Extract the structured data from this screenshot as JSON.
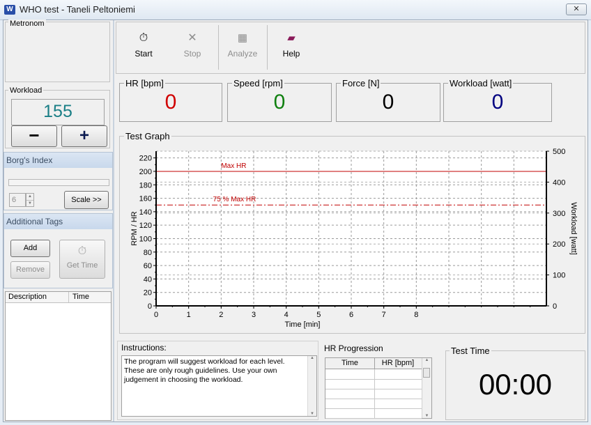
{
  "window": {
    "title": "WHO test - Taneli Peltoniemi",
    "app_icon": "W",
    "close": "✕"
  },
  "metronom": {
    "label": "Metronom"
  },
  "workload": {
    "label": "Workload",
    "value": "155",
    "minus": "−",
    "plus": "+"
  },
  "borg": {
    "label": "Borg's Index",
    "spin_value": "6",
    "scale_button": "Scale >>"
  },
  "tags": {
    "label": "Additional Tags",
    "add": "Add",
    "remove": "Remove",
    "get_time": "Get Time",
    "columns": [
      "Description",
      "Time"
    ]
  },
  "toolbar": {
    "start": "Start",
    "stop": "Stop",
    "analyze": "Analyze",
    "help": "Help"
  },
  "readouts": [
    {
      "label": "HR [bpm]",
      "value": "0",
      "color": "#d00000"
    },
    {
      "label": "Speed [rpm]",
      "value": "0",
      "color": "#108010"
    },
    {
      "label": "Force [N]",
      "value": "0",
      "color": "#000000"
    },
    {
      "label": "Workload [watt]",
      "value": "0",
      "color": "#000080"
    }
  ],
  "graph": {
    "label": "Test Graph"
  },
  "chart_data": {
    "type": "line",
    "xlabel": "Time [min]",
    "ylabel": "RPM / HR",
    "y2label": "Workload [watt]",
    "xlim": [
      0,
      12
    ],
    "ylim": [
      0,
      230
    ],
    "y2lim": [
      0,
      500
    ],
    "x_ticks": [
      0,
      1,
      2,
      3,
      4,
      5,
      6,
      7,
      8
    ],
    "y_ticks": [
      0,
      20,
      40,
      60,
      80,
      100,
      120,
      140,
      160,
      180,
      200,
      220
    ],
    "y2_ticks": [
      0,
      100,
      200,
      300,
      400,
      500
    ],
    "reference_lines": [
      {
        "name": "Max HR",
        "y": 200,
        "style": "solid",
        "color": "#c00000"
      },
      {
        "name": "75 % Max HR",
        "y": 150,
        "style": "dashdot",
        "color": "#c00000"
      }
    ],
    "grid": true
  },
  "instructions": {
    "label": "Instructions:",
    "text": "The program will suggest workload for each level. These are only rough guidelines. Use your own judgement in choosing the workload."
  },
  "hr_progression": {
    "label": "HR Progression",
    "columns": [
      "Time",
      "HR [bpm]"
    ]
  },
  "test_time": {
    "label": "Test Time",
    "value": "00:00"
  }
}
